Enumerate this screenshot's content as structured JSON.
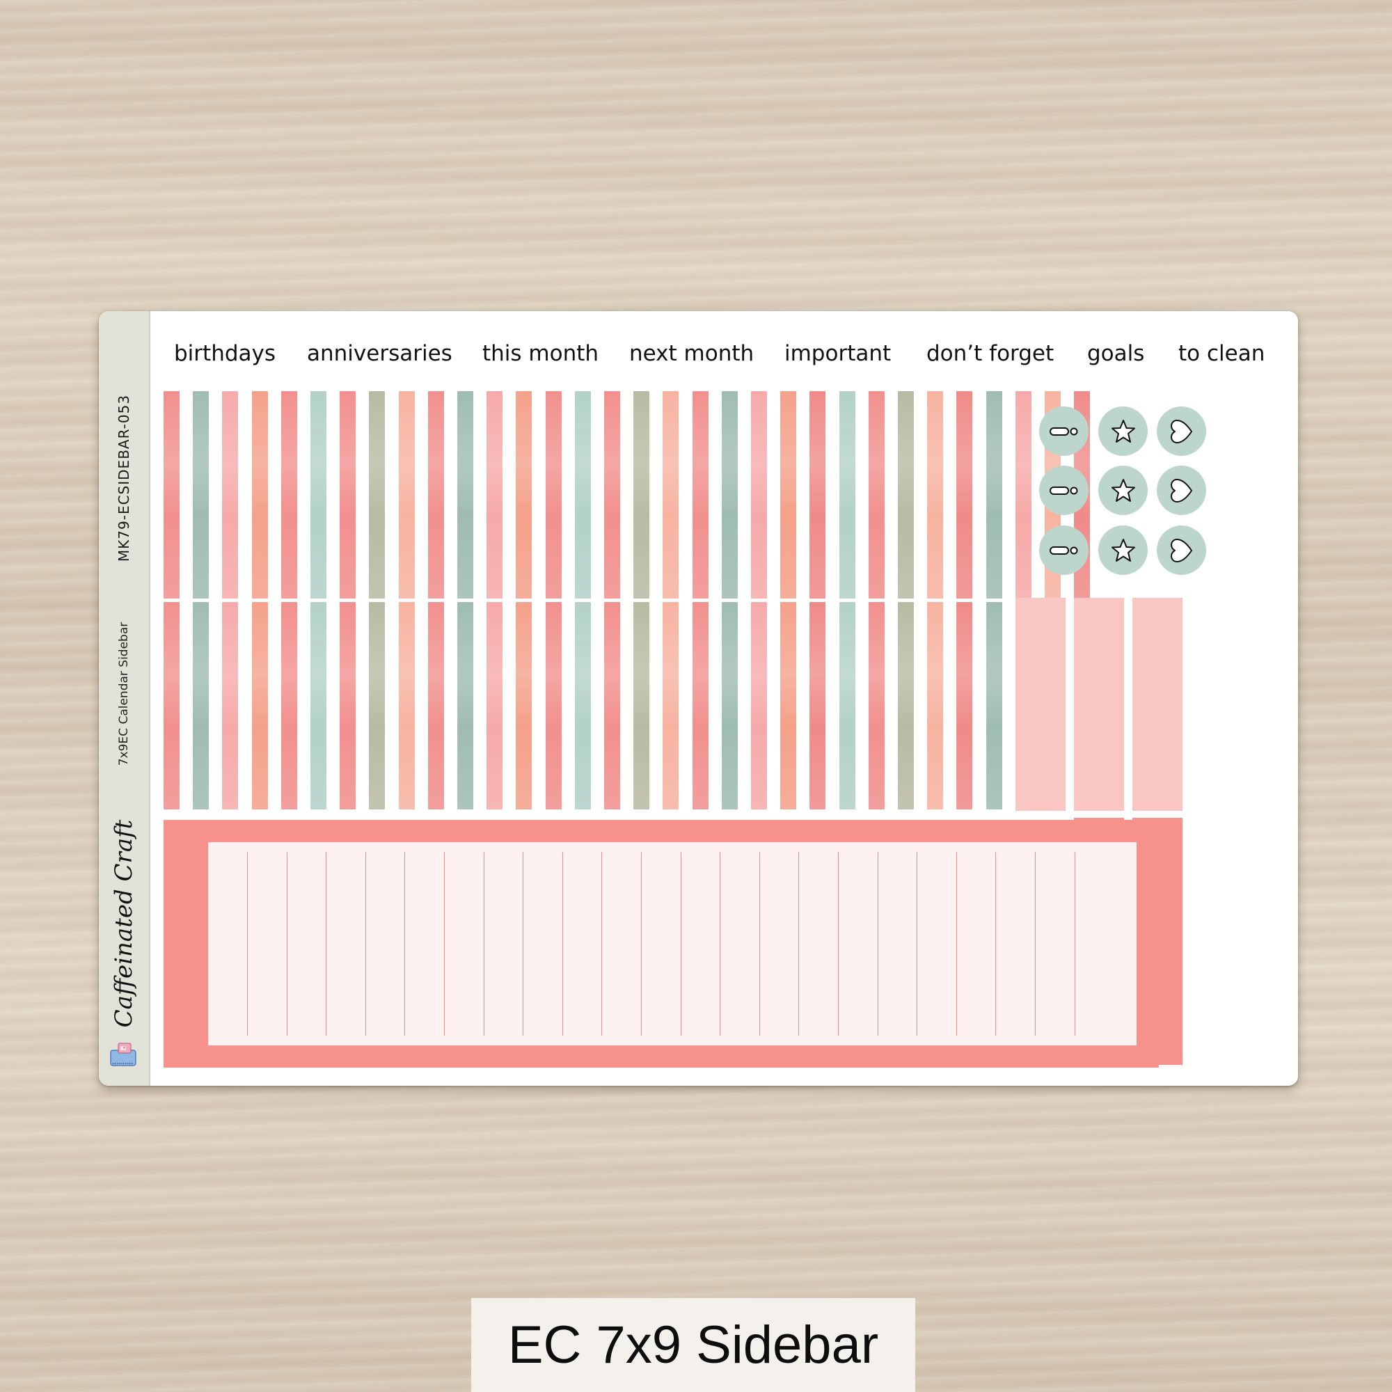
{
  "sheet": {
    "spine": {
      "product_code": "MK79-ECSIDEBAR-053",
      "subtitle": "7x9EC Calendar Sidebar",
      "brand": "Caffeinated Craft",
      "logo_icon": "coffee-cup-on-planner-icon"
    },
    "labels": [
      "birthdays",
      "anniversaries",
      "this month",
      "next month",
      "important",
      "don’t forget",
      "goals",
      "to clean"
    ],
    "stripe_colors": {
      "coral": "#f1908e",
      "teal": "#9fbcb3",
      "pink": "#f6aaa9",
      "orange": "#f4a18a",
      "light_teal": "#b3d1c8",
      "sage": "#b8bba3",
      "peach": "#f7b3a0",
      "red": "#ef8b89"
    },
    "stripe_sequence": [
      "coral",
      "teal",
      "pink",
      "orange",
      "coral",
      "light_teal",
      "coral",
      "sage",
      "peach",
      "coral",
      "teal",
      "pink",
      "orange",
      "coral",
      "light_teal",
      "coral",
      "sage",
      "peach",
      "coral",
      "teal",
      "pink",
      "orange",
      "red",
      "light_teal",
      "coral",
      "sage",
      "peach",
      "red",
      "teal",
      "pink",
      "peach",
      "red"
    ],
    "stripe_rows": 2,
    "icon_circles": {
      "columns": [
        "exclamation-icon",
        "star-icon",
        "heart-icon"
      ],
      "rows": 3,
      "circle_color": "#bcd6cd"
    },
    "blocks": {
      "pink_block_color": "#f9c6c4",
      "coral_block_color": "#f6918b",
      "pink_block_count": 3,
      "coral_block_count": 2
    },
    "lined_box": {
      "frame_color": "#f6918b",
      "fill_color": "#fdf1f1",
      "line_color": "#e48d8a",
      "line_count": 22
    }
  },
  "caption": "EC 7x9 Sidebar"
}
